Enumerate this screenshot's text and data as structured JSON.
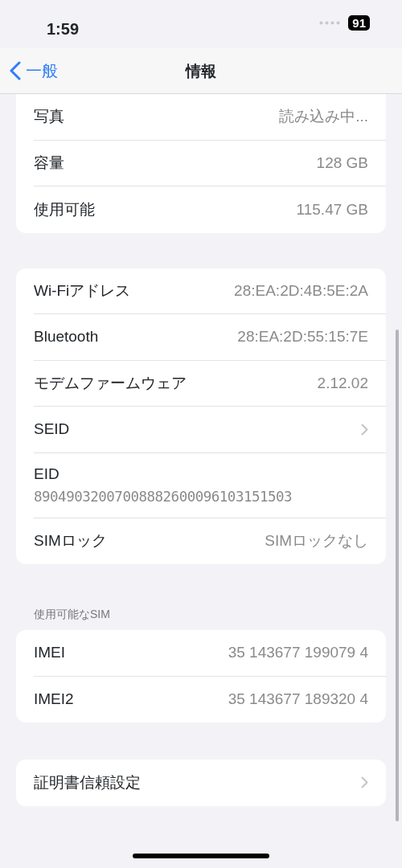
{
  "status_bar": {
    "time": "1:59",
    "battery": "91"
  },
  "nav": {
    "back": "一般",
    "title": "情報"
  },
  "groups": [
    {
      "rows": [
        {
          "kind": "value",
          "label": "写真",
          "value": "読み込み中..."
        },
        {
          "kind": "value",
          "label": "容量",
          "value": "128 GB"
        },
        {
          "kind": "value",
          "label": "使用可能",
          "value": "115.47 GB"
        }
      ]
    },
    {
      "rows": [
        {
          "kind": "value",
          "label": "Wi-Fiアドレス",
          "value": "28:EA:2D:4B:5E:2A"
        },
        {
          "kind": "value",
          "label": "Bluetooth",
          "value": "28:EA:2D:55:15:7E"
        },
        {
          "kind": "value",
          "label": "モデムファームウェア",
          "value": "2.12.02"
        },
        {
          "kind": "chevron",
          "label": "SEID"
        },
        {
          "kind": "stacked",
          "label": "EID",
          "value": "89049032007008882600096103151503"
        },
        {
          "kind": "value",
          "label": "SIMロック",
          "value": "SIMロックなし"
        }
      ]
    },
    {
      "header": "使用可能なSIM",
      "rows": [
        {
          "kind": "value",
          "label": "IMEI",
          "value": "35 143677 199079 4"
        },
        {
          "kind": "value",
          "label": "IMEI2",
          "value": "35 143677 189320 4"
        }
      ]
    },
    {
      "rows": [
        {
          "kind": "chevron",
          "label": "証明書信頼設定"
        }
      ]
    }
  ]
}
